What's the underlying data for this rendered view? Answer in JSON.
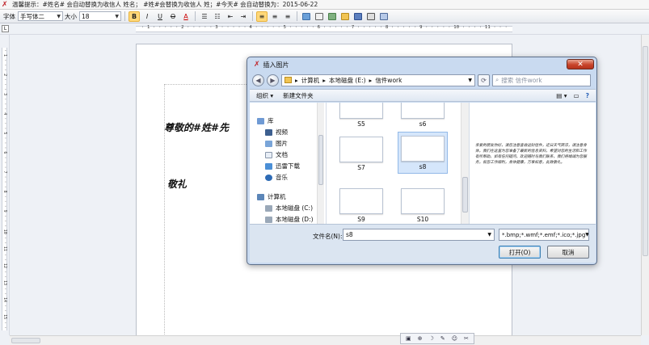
{
  "hint": {
    "text": "温馨提示：#姓名# 会自动替换为收信人 姓名；  #姓#会替换为收信人 姓；#今天# 会自动替换为：2015-06-22"
  },
  "toolbar": {
    "font_label": "字体",
    "font_value": "手写体二",
    "size_label": "大小",
    "size_value": "18",
    "bold": "B",
    "italic": "I",
    "underline": "U",
    "strike": "O",
    "color": "A"
  },
  "ruler": {
    "numbers": "· 1 · · · · · 2 · · · · · 3 · · · · · 4 · · · · · 5 · · · · · 6 · · · · · 7 · · · · · 8 · · · · · 9 · · · · · 10 · · · · 11 · · · · 12 · · · · 13 · · · · 14 · · · · 15 · · · · 16 · · · · 17 · · · · 18 · · · · 19 ·",
    "vnumbers": "· 1 · · · 2 · · · 3 · · · 4 · · · 5 · · · 6 · · · 7 · · · 8 · · · 9 · · · 10 · · 11 · · 12 · · 13 · · 14 · · 15 · · 16 · · 17 · ·"
  },
  "document": {
    "greeting": "尊敬的#姓#先",
    "closing": "敬礼"
  },
  "dialog": {
    "title": "插入图片",
    "close": "✕",
    "path": [
      "计算机",
      "本地磁盘 (E:)",
      "信件work"
    ],
    "search_placeholder": "搜索 信件work",
    "organize": "组织 ▾",
    "new_folder": "新建文件夹",
    "nav": {
      "library": "库",
      "items": [
        "视频",
        "图片",
        "文档",
        "迅雷下载",
        "音乐"
      ],
      "computer": "计算机",
      "drives": [
        "本地磁盘 (C:)",
        "本地磁盘 (D:)"
      ]
    },
    "files": [
      "S5",
      "s6",
      "S7",
      "s8",
      "S9",
      "S10"
    ],
    "selected_file": "s8",
    "preview_text": "亲爱的朋友你好，请您注意查收这封信件，近日天气转凉，请注意身体，我们在这里为您准备了最新的信息资料，希望对您的生活和工作有所帮助。如有任何疑问，欢迎随时与我们联系，我们将竭诚为您服务，祝您工作顺利，身体健康，万事如意，此致敬礼。",
    "filename_label": "文件名(N):",
    "filename_value": "s8",
    "filetype": "*.bmp;*.wmf;*.emf;*.ico;*.jpg",
    "open": "打开(O)",
    "cancel": "取消"
  }
}
